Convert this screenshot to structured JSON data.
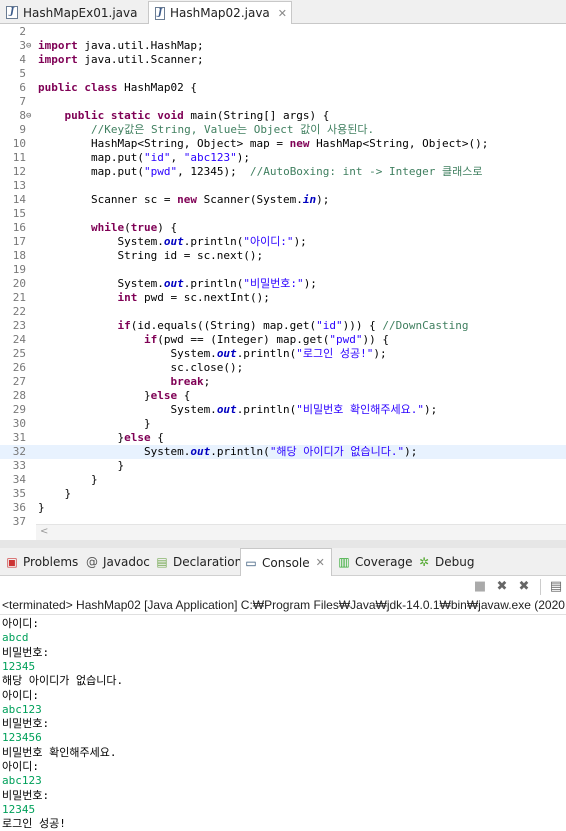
{
  "editor_tabs": [
    {
      "label": "HashMapEx01.java"
    },
    {
      "label": "HashMap02.java"
    }
  ],
  "code": {
    "lines": [
      {
        "n": "2",
        "parts": []
      },
      {
        "n": "3",
        "fold": "⊖",
        "parts": [
          {
            "c": "kw",
            "t": "import"
          },
          {
            "c": "",
            "t": " java.util.HashMap;"
          }
        ]
      },
      {
        "n": "4",
        "parts": [
          {
            "c": "kw",
            "t": "import"
          },
          {
            "c": "",
            "t": " java.util.Scanner;"
          }
        ]
      },
      {
        "n": "5",
        "parts": []
      },
      {
        "n": "6",
        "parts": [
          {
            "c": "kw",
            "t": "public class"
          },
          {
            "c": "",
            "t": " HashMap02 {"
          }
        ]
      },
      {
        "n": "7",
        "parts": []
      },
      {
        "n": "8",
        "fold": "⊖",
        "parts": [
          {
            "c": "",
            "t": "    "
          },
          {
            "c": "kw",
            "t": "public static void"
          },
          {
            "c": "",
            "t": " main(String[] args) {"
          }
        ]
      },
      {
        "n": "9",
        "parts": [
          {
            "c": "",
            "t": "        "
          },
          {
            "c": "cm",
            "t": "//Key값은 String, Value는 Object 값이 사용된다."
          }
        ]
      },
      {
        "n": "10",
        "parts": [
          {
            "c": "",
            "t": "        HashMap<String, Object> map = "
          },
          {
            "c": "kw",
            "t": "new"
          },
          {
            "c": "",
            "t": " HashMap<String, Object>();"
          }
        ]
      },
      {
        "n": "11",
        "parts": [
          {
            "c": "",
            "t": "        map.put("
          },
          {
            "c": "str",
            "t": "\"id\""
          },
          {
            "c": "",
            "t": ", "
          },
          {
            "c": "str",
            "t": "\"abc123\""
          },
          {
            "c": "",
            "t": ");"
          }
        ]
      },
      {
        "n": "12",
        "parts": [
          {
            "c": "",
            "t": "        map.put("
          },
          {
            "c": "str",
            "t": "\"pwd\""
          },
          {
            "c": "",
            "t": ", 12345);  "
          },
          {
            "c": "cm",
            "t": "//AutoBoxing: int -> Integer 클래스로"
          }
        ]
      },
      {
        "n": "13",
        "parts": []
      },
      {
        "n": "14",
        "parts": [
          {
            "c": "",
            "t": "        Scanner sc = "
          },
          {
            "c": "kw",
            "t": "new"
          },
          {
            "c": "",
            "t": " Scanner(System."
          },
          {
            "c": "fld",
            "t": "in"
          },
          {
            "c": "",
            "t": ");"
          }
        ]
      },
      {
        "n": "15",
        "parts": []
      },
      {
        "n": "16",
        "parts": [
          {
            "c": "",
            "t": "        "
          },
          {
            "c": "kw",
            "t": "while"
          },
          {
            "c": "",
            "t": "("
          },
          {
            "c": "kw",
            "t": "true"
          },
          {
            "c": "",
            "t": ") {"
          }
        ]
      },
      {
        "n": "17",
        "parts": [
          {
            "c": "",
            "t": "            System."
          },
          {
            "c": "fld",
            "t": "out"
          },
          {
            "c": "",
            "t": ".println("
          },
          {
            "c": "str",
            "t": "\"아이디:\""
          },
          {
            "c": "",
            "t": ");"
          }
        ]
      },
      {
        "n": "18",
        "parts": [
          {
            "c": "",
            "t": "            String id = sc.next();"
          }
        ]
      },
      {
        "n": "19",
        "parts": []
      },
      {
        "n": "20",
        "parts": [
          {
            "c": "",
            "t": "            System."
          },
          {
            "c": "fld",
            "t": "out"
          },
          {
            "c": "",
            "t": ".println("
          },
          {
            "c": "str",
            "t": "\"비밀번호:\""
          },
          {
            "c": "",
            "t": ");"
          }
        ]
      },
      {
        "n": "21",
        "parts": [
          {
            "c": "",
            "t": "            "
          },
          {
            "c": "kw",
            "t": "int"
          },
          {
            "c": "",
            "t": " pwd = sc.nextInt();"
          }
        ]
      },
      {
        "n": "22",
        "parts": []
      },
      {
        "n": "23",
        "parts": [
          {
            "c": "",
            "t": "            "
          },
          {
            "c": "kw",
            "t": "if"
          },
          {
            "c": "",
            "t": "(id.equals((String) map.get("
          },
          {
            "c": "str",
            "t": "\"id\""
          },
          {
            "c": "",
            "t": "))) { "
          },
          {
            "c": "cm",
            "t": "//DownCasting"
          }
        ]
      },
      {
        "n": "24",
        "parts": [
          {
            "c": "",
            "t": "                "
          },
          {
            "c": "kw",
            "t": "if"
          },
          {
            "c": "",
            "t": "(pwd == (Integer) map.get("
          },
          {
            "c": "str",
            "t": "\"pwd\""
          },
          {
            "c": "",
            "t": ")) {"
          }
        ]
      },
      {
        "n": "25",
        "parts": [
          {
            "c": "",
            "t": "                    System."
          },
          {
            "c": "fld",
            "t": "out"
          },
          {
            "c": "",
            "t": ".println("
          },
          {
            "c": "str",
            "t": "\"로그인 성공!\""
          },
          {
            "c": "",
            "t": ");"
          }
        ]
      },
      {
        "n": "26",
        "parts": [
          {
            "c": "",
            "t": "                    sc.close();"
          }
        ]
      },
      {
        "n": "27",
        "parts": [
          {
            "c": "",
            "t": "                    "
          },
          {
            "c": "kw",
            "t": "break"
          },
          {
            "c": "",
            "t": ";"
          }
        ]
      },
      {
        "n": "28",
        "parts": [
          {
            "c": "",
            "t": "                }"
          },
          {
            "c": "kw",
            "t": "else"
          },
          {
            "c": "",
            "t": " {"
          }
        ]
      },
      {
        "n": "29",
        "parts": [
          {
            "c": "",
            "t": "                    System."
          },
          {
            "c": "fld",
            "t": "out"
          },
          {
            "c": "",
            "t": ".println("
          },
          {
            "c": "str",
            "t": "\"비밀번호 확인해주세요.\""
          },
          {
            "c": "",
            "t": ");"
          }
        ]
      },
      {
        "n": "30",
        "parts": [
          {
            "c": "",
            "t": "                }"
          }
        ]
      },
      {
        "n": "31",
        "parts": [
          {
            "c": "",
            "t": "            }"
          },
          {
            "c": "kw",
            "t": "else"
          },
          {
            "c": "",
            "t": " {"
          }
        ]
      },
      {
        "n": "32",
        "hl": true,
        "parts": [
          {
            "c": "",
            "t": "                System."
          },
          {
            "c": "fld",
            "t": "out"
          },
          {
            "c": "",
            "t": ".println("
          },
          {
            "c": "str",
            "t": "\"해당 아이디가 없습니다.\""
          },
          {
            "c": "",
            "t": ");"
          }
        ]
      },
      {
        "n": "33",
        "parts": [
          {
            "c": "",
            "t": "            }"
          }
        ]
      },
      {
        "n": "34",
        "parts": [
          {
            "c": "",
            "t": "        }"
          }
        ]
      },
      {
        "n": "35",
        "parts": [
          {
            "c": "",
            "t": "    }"
          }
        ]
      },
      {
        "n": "36",
        "parts": [
          {
            "c": "",
            "t": "}"
          }
        ]
      },
      {
        "n": "37",
        "parts": []
      }
    ]
  },
  "views": {
    "tabs": [
      {
        "label": "Problems",
        "icon": "problems-icon"
      },
      {
        "label": "Javadoc",
        "icon": "javadoc-icon"
      },
      {
        "label": "Declaration",
        "icon": "declaration-icon"
      },
      {
        "label": "Console",
        "icon": "console-icon"
      },
      {
        "label": "Coverage",
        "icon": "coverage-icon"
      },
      {
        "label": "Debug",
        "icon": "debug-icon"
      }
    ]
  },
  "console": {
    "status": "<terminated> HashMap02 [Java Application] C:₩Program Files₩Java₩jdk-14.0.1₩bin₩javaw.exe  (2020.",
    "lines": [
      {
        "t": "아이디:",
        "k": "out"
      },
      {
        "t": "abcd",
        "k": "in"
      },
      {
        "t": "비밀번호:",
        "k": "out"
      },
      {
        "t": "12345",
        "k": "in"
      },
      {
        "t": "해당 아이디가 없습니다.",
        "k": "out"
      },
      {
        "t": "아이디:",
        "k": "out"
      },
      {
        "t": "abc123",
        "k": "in"
      },
      {
        "t": "비밀번호:",
        "k": "out"
      },
      {
        "t": "123456",
        "k": "in"
      },
      {
        "t": "비밀번호 확인해주세요.",
        "k": "out"
      },
      {
        "t": "아이디:",
        "k": "out"
      },
      {
        "t": "abc123",
        "k": "in"
      },
      {
        "t": "비밀번호:",
        "k": "out"
      },
      {
        "t": "12345",
        "k": "in"
      },
      {
        "t": "로그인 성공!",
        "k": "out"
      }
    ]
  }
}
